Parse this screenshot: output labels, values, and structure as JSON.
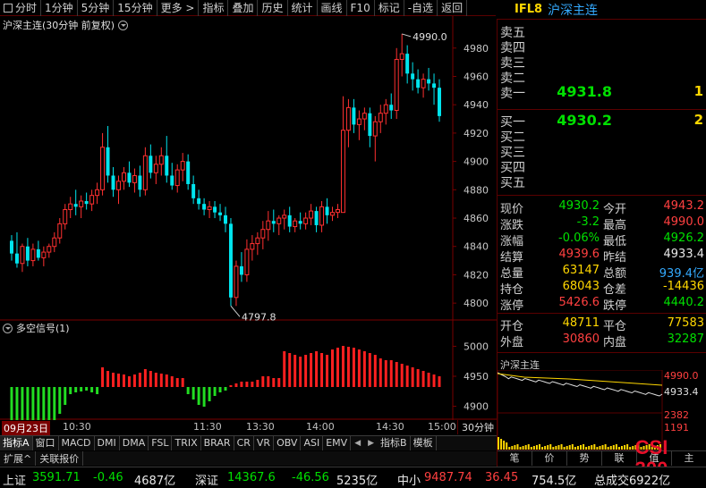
{
  "toolbar": {
    "items": [
      "分时",
      "1分钟",
      "5分钟",
      "15分钟",
      "更多 >",
      "指标",
      "叠加",
      "历史",
      "统计",
      "画线",
      "F10",
      "标记",
      "-自选",
      "返回"
    ]
  },
  "header": {
    "code": "IFL8",
    "name": "沪深主连"
  },
  "chart": {
    "title": "沪深主连(30分钟 前复权)",
    "indicator_title": "多空信号(1)",
    "high_label": "4990.0",
    "low_label": "4797.8",
    "period_label": "30分钟"
  },
  "chart_data": {
    "type": "candlestick",
    "y_axis_ticks": [
      4980,
      4960,
      4940,
      4920,
      4900,
      4880,
      4860,
      4840,
      4820,
      4800
    ],
    "ylim": [
      4790,
      4995
    ],
    "indicator_ticks": [
      5000,
      4950,
      4900
    ],
    "indicator_ylim": [
      4880,
      5020
    ],
    "time_labels": [
      "09月23日",
      "10:30",
      "11:30",
      "13:30",
      "14:00",
      "14:30",
      "15:00"
    ],
    "candles": [
      [
        4844,
        4848,
        4830,
        4835
      ],
      [
        4835,
        4850,
        4825,
        4828
      ],
      [
        4828,
        4842,
        4822,
        4840
      ],
      [
        4840,
        4846,
        4826,
        4830
      ],
      [
        4830,
        4842,
        4826,
        4838
      ],
      [
        4838,
        4844,
        4830,
        4832
      ],
      [
        4832,
        4840,
        4826,
        4836
      ],
      [
        4836,
        4842,
        4832,
        4840
      ],
      [
        4840,
        4850,
        4836,
        4846
      ],
      [
        4846,
        4860,
        4842,
        4856
      ],
      [
        4856,
        4870,
        4852,
        4866
      ],
      [
        4866,
        4875,
        4860,
        4870
      ],
      [
        4870,
        4880,
        4862,
        4868
      ],
      [
        4868,
        4876,
        4860,
        4872
      ],
      [
        4872,
        4878,
        4866,
        4870
      ],
      [
        4870,
        4880,
        4865,
        4876
      ],
      [
        4876,
        4885,
        4870,
        4880
      ],
      [
        4880,
        4920,
        4876,
        4910
      ],
      [
        4910,
        4925,
        4885,
        4890
      ],
      [
        4890,
        4896,
        4875,
        4880
      ],
      [
        4880,
        4890,
        4870,
        4886
      ],
      [
        4886,
        4896,
        4880,
        4892
      ],
      [
        4892,
        4900,
        4882,
        4885
      ],
      [
        4885,
        4895,
        4878,
        4890
      ],
      [
        4890,
        4897,
        4875,
        4880
      ],
      [
        4880,
        4910,
        4876,
        4904
      ],
      [
        4904,
        4912,
        4888,
        4892
      ],
      [
        4892,
        4904,
        4884,
        4898
      ],
      [
        4898,
        4910,
        4890,
        4904
      ],
      [
        4904,
        4918,
        4885,
        4890
      ],
      [
        4890,
        4899,
        4880,
        4883
      ],
      [
        4883,
        4898,
        4878,
        4894
      ],
      [
        4894,
        4906,
        4886,
        4900
      ],
      [
        4900,
        4905,
        4880,
        4884
      ],
      [
        4884,
        4890,
        4870,
        4874
      ],
      [
        4874,
        4880,
        4866,
        4870
      ],
      [
        4870,
        4874,
        4862,
        4866
      ],
      [
        4866,
        4872,
        4860,
        4868
      ],
      [
        4868,
        4872,
        4860,
        4864
      ],
      [
        4864,
        4870,
        4858,
        4862
      ],
      [
        4862,
        4868,
        4850,
        4856
      ],
      [
        4856,
        4860,
        4798,
        4804
      ],
      [
        4804,
        4830,
        4798,
        4826
      ],
      [
        4826,
        4836,
        4815,
        4820
      ],
      [
        4820,
        4845,
        4815,
        4838
      ],
      [
        4838,
        4848,
        4830,
        4842
      ],
      [
        4842,
        4850,
        4834,
        4846
      ],
      [
        4846,
        4858,
        4838,
        4852
      ],
      [
        4852,
        4865,
        4844,
        4858
      ],
      [
        4858,
        4866,
        4850,
        4856
      ],
      [
        4856,
        4862,
        4848,
        4860
      ],
      [
        4860,
        4866,
        4852,
        4862
      ],
      [
        4862,
        4868,
        4850,
        4854
      ],
      [
        4854,
        4860,
        4850,
        4858
      ],
      [
        4858,
        4864,
        4852,
        4856
      ],
      [
        4856,
        4864,
        4852,
        4860
      ],
      [
        4860,
        4870,
        4855,
        4865
      ],
      [
        4865,
        4868,
        4850,
        4855
      ],
      [
        4855,
        4872,
        4850,
        4868
      ],
      [
        4868,
        4874,
        4856,
        4862
      ],
      [
        4862,
        4868,
        4858,
        4864
      ],
      [
        4864,
        4870,
        4860,
        4866
      ],
      [
        4864,
        4946,
        4900,
        4922
      ],
      [
        4922,
        4944,
        4910,
        4938
      ],
      [
        4938,
        4944,
        4920,
        4926
      ],
      [
        4926,
        4936,
        4915,
        4930
      ],
      [
        4930,
        4938,
        4922,
        4934
      ],
      [
        4934,
        4938,
        4910,
        4918
      ],
      [
        4918,
        4932,
        4900,
        4928
      ],
      [
        4928,
        4940,
        4920,
        4934
      ],
      [
        4934,
        4944,
        4926,
        4940
      ],
      [
        4940,
        4948,
        4930,
        4936
      ],
      [
        4936,
        4980,
        4930,
        4972
      ],
      [
        4972,
        4990,
        4960,
        4976
      ],
      [
        4976,
        4982,
        4955,
        4962
      ],
      [
        4962,
        4970,
        4950,
        4958
      ],
      [
        4958,
        4965,
        4948,
        4952
      ],
      [
        4952,
        4962,
        4945,
        4958
      ],
      [
        4958,
        4966,
        4950,
        4955
      ],
      [
        4955,
        4962,
        4940,
        4952
      ],
      [
        4952,
        4958,
        4928,
        4932
      ]
    ],
    "signals": [
      [
        -40
      ],
      [
        -40
      ],
      [
        -40
      ],
      [
        -40
      ],
      [
        -40
      ],
      [
        -40
      ],
      [
        -40
      ],
      [
        -40
      ],
      [
        -38
      ],
      [
        -30
      ],
      [
        -20
      ],
      [
        -8
      ],
      [
        -6
      ],
      [
        -5
      ],
      [
        -4
      ],
      [
        -6
      ],
      [
        -8
      ],
      [
        22
      ],
      [
        18
      ],
      [
        16
      ],
      [
        15
      ],
      [
        14
      ],
      [
        12
      ],
      [
        14
      ],
      [
        16
      ],
      [
        20
      ],
      [
        18
      ],
      [
        16
      ],
      [
        15
      ],
      [
        14
      ],
      [
        12
      ],
      [
        10
      ],
      [
        10
      ],
      [
        -8
      ],
      [
        -14
      ],
      [
        -20
      ],
      [
        -22
      ],
      [
        -16
      ],
      [
        -10
      ],
      [
        -6
      ],
      [
        -4
      ],
      [
        2
      ],
      [
        4
      ],
      [
        6
      ],
      [
        6
      ],
      [
        6
      ],
      [
        8
      ],
      [
        12
      ],
      [
        12
      ],
      [
        10
      ],
      [
        10
      ],
      [
        40
      ],
      [
        38
      ],
      [
        36
      ],
      [
        34
      ],
      [
        36
      ],
      [
        38
      ],
      [
        40
      ],
      [
        38
      ],
      [
        36
      ],
      [
        42
      ],
      [
        44
      ],
      [
        46
      ],
      [
        45
      ],
      [
        44
      ],
      [
        42
      ],
      [
        40
      ],
      [
        38
      ],
      [
        36
      ],
      [
        32
      ],
      [
        30
      ],
      [
        30
      ],
      [
        28
      ],
      [
        26
      ],
      [
        24
      ],
      [
        22
      ],
      [
        20
      ],
      [
        18
      ],
      [
        16
      ],
      [
        14
      ],
      [
        12
      ]
    ]
  },
  "orderbook": {
    "asks": [
      {
        "label": "卖五",
        "price": "",
        "vol": ""
      },
      {
        "label": "卖四",
        "price": "",
        "vol": ""
      },
      {
        "label": "卖三",
        "price": "",
        "vol": ""
      },
      {
        "label": "卖二",
        "price": "",
        "vol": ""
      },
      {
        "label": "卖一",
        "price": "4931.8",
        "vol": "1"
      }
    ],
    "bids": [
      {
        "label": "买一",
        "price": "4930.2",
        "vol": "2"
      },
      {
        "label": "买二",
        "price": "",
        "vol": ""
      },
      {
        "label": "买三",
        "price": "",
        "vol": ""
      },
      {
        "label": "买四",
        "price": "",
        "vol": ""
      },
      {
        "label": "买五",
        "price": "",
        "vol": ""
      }
    ]
  },
  "quotes": [
    {
      "l1": "现价",
      "v1": "4930.2",
      "c1": "dn",
      "l2": "今开",
      "v2": "4943.2",
      "c2": "up"
    },
    {
      "l1": "涨跌",
      "v1": "-3.2",
      "c1": "dn",
      "l2": "最高",
      "v2": "4990.0",
      "c2": "up"
    },
    {
      "l1": "涨幅",
      "v1": "-0.06%",
      "c1": "dn",
      "l2": "最低",
      "v2": "4926.2",
      "c2": "dn"
    },
    {
      "l1": "结算",
      "v1": "4939.6",
      "c1": "up",
      "l2": "昨结",
      "v2": "4933.4",
      "c2": "wh"
    },
    {
      "l1": "总量",
      "v1": "63147",
      "c1": "yl",
      "l2": "总额",
      "v2": "939.4亿",
      "c2": "cy"
    },
    {
      "l1": "持仓",
      "v1": "68043",
      "c1": "yl",
      "l2": "仓差",
      "v2": "-14436",
      "c2": "yl"
    },
    {
      "l1": "涨停",
      "v1": "5426.6",
      "c1": "up",
      "l2": "跌停",
      "v2": "4440.2",
      "c2": "dn"
    },
    {
      "l1": "开仓",
      "v1": "48711",
      "c1": "yl",
      "l2": "平仓",
      "v2": "77583",
      "c2": "yl"
    },
    {
      "l1": "外盘",
      "v1": "30860",
      "c1": "up",
      "l2": "内盘",
      "v2": "32287",
      "c2": "dn"
    }
  ],
  "mini": {
    "title": "沪深主连",
    "price_top": "4990.0",
    "price_mid": "4933.4",
    "vol_top": "2382",
    "vol_mid": "1191"
  },
  "right_tabs": [
    "笔",
    "价",
    "势",
    "联",
    "值",
    "主"
  ],
  "indicator_tabs": [
    "指标A",
    "窗口",
    "MACD",
    "DMI",
    "DMA",
    "FSL",
    "TRIX",
    "BRAR",
    "CR",
    "VR",
    "OBV",
    "ASI",
    "EMV"
  ],
  "indicator_tab_after": [
    "指标B",
    "模板"
  ],
  "ext_tabs": [
    "扩展^",
    "关联报价"
  ],
  "logo_text": [
    "CSI",
    "300"
  ],
  "status": [
    {
      "label": "上证",
      "value": "3591.71",
      "change": "-0.46",
      "amount": "4687亿"
    },
    {
      "label": "深证",
      "value": "14367.6",
      "change": "-46.56",
      "amount": "5235亿"
    },
    {
      "label": "中小",
      "value": "9487.74",
      "change": "36.45",
      "amount": "754.5亿"
    },
    {
      "label": "总成交",
      "value": "",
      "change": "",
      "amount": ""
    }
  ],
  "status_truncated": "总成交6922亿"
}
